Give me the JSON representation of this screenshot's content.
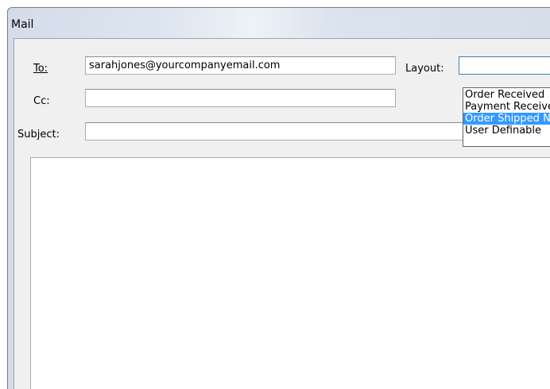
{
  "window": {
    "title": "Mail"
  },
  "fields": {
    "to_label": "To:",
    "to_value": "sarahjones@yourcompanyemail.com",
    "cc_label": "Cc:",
    "cc_value": "",
    "subject_label": "Subject:",
    "subject_value": "",
    "layout_label": "Layout:",
    "layout_value": ""
  },
  "layout_dropdown": {
    "options": [
      {
        "label": "Order Received",
        "selected": false
      },
      {
        "label": "Payment Received",
        "selected": false
      },
      {
        "label": "Order Shipped Notice",
        "selected": true
      },
      {
        "label": "User Definable",
        "selected": false
      }
    ]
  },
  "message_body": "",
  "colors": {
    "selection": "#3399ff",
    "dialog_background": "#f0f0f0"
  }
}
